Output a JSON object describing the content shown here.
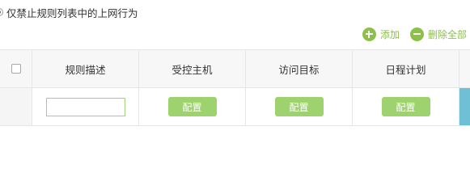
{
  "mode": {
    "label": "仅禁止规则列表中的上网行为",
    "selected": true
  },
  "toolbar": {
    "add_label": "添加",
    "delete_all_label": "删除全部",
    "accent_color": "#8cc04a"
  },
  "table": {
    "headers": {
      "description": "规则描述",
      "host": "受控主机",
      "target": "访问目标",
      "schedule": "日程计划"
    },
    "new_row": {
      "description_value": "",
      "host_button": "配置",
      "target_button": "配置",
      "schedule_button": "配置"
    }
  },
  "icons": {
    "add": "plus-circle-icon",
    "delete_all": "minus-circle-icon"
  },
  "colors": {
    "button_green": "#9ed26e",
    "side_strip": "#6fbfd5"
  }
}
